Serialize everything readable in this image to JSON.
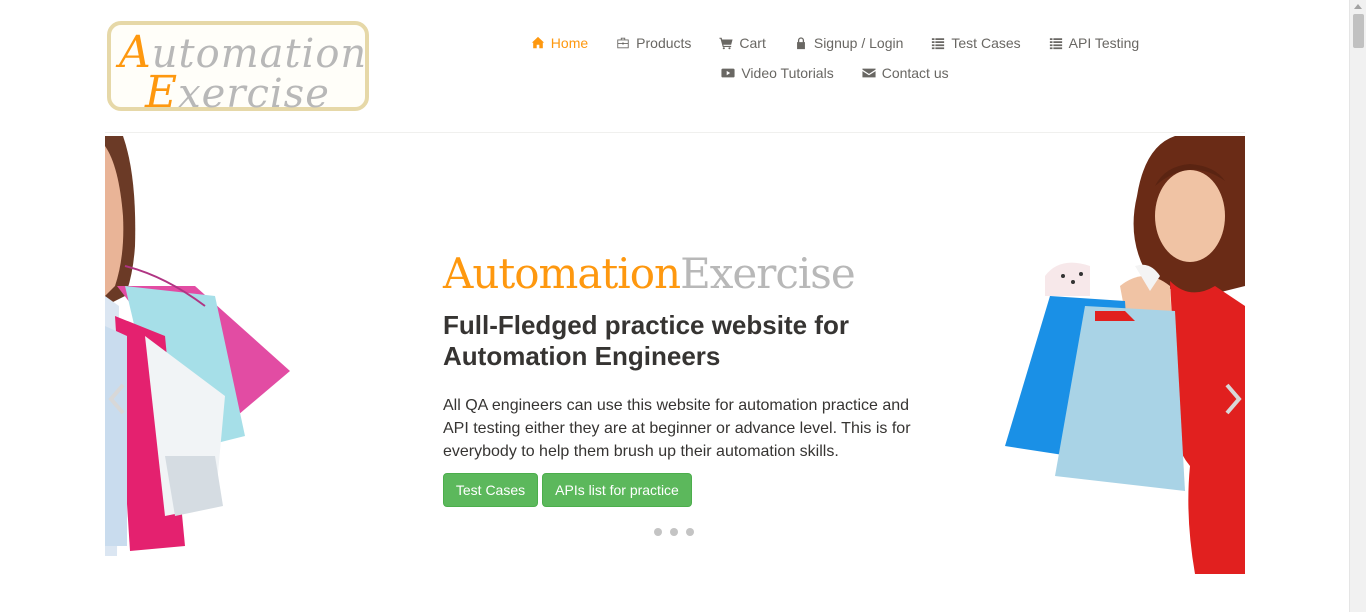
{
  "brand": {
    "logo_line1_cap": "A",
    "logo_line1_rest": "utomation",
    "logo_line2_cap": "E",
    "logo_line2_rest": "xercise",
    "accent_color": "#fe980f",
    "secondary_color": "#b8b8b8",
    "button_color": "#5cb85c"
  },
  "nav": {
    "row1": [
      {
        "label": "Home",
        "icon": "home-icon",
        "active": true
      },
      {
        "label": "Products",
        "icon": "briefcase-icon"
      },
      {
        "label": "Cart",
        "icon": "cart-icon"
      },
      {
        "label": "Signup / Login",
        "icon": "lock-icon"
      },
      {
        "label": "Test Cases",
        "icon": "list-icon"
      },
      {
        "label": "API Testing",
        "icon": "list-icon"
      }
    ],
    "row2": [
      {
        "label": "Video Tutorials",
        "icon": "youtube-play-icon"
      },
      {
        "label": "Contact us",
        "icon": "envelope-icon"
      }
    ]
  },
  "slider": {
    "title_part1": "Automation",
    "title_part2": "Exercise",
    "subtitle": "Full-Fledged practice website for Automation Engineers",
    "text": "All QA engineers can use this website for automation practice and API testing either they are at beginner or advance level. This is for everybody to help them brush up their automation skills.",
    "button1": "Test Cases",
    "button2": "APIs list for practice",
    "dots": 3
  }
}
